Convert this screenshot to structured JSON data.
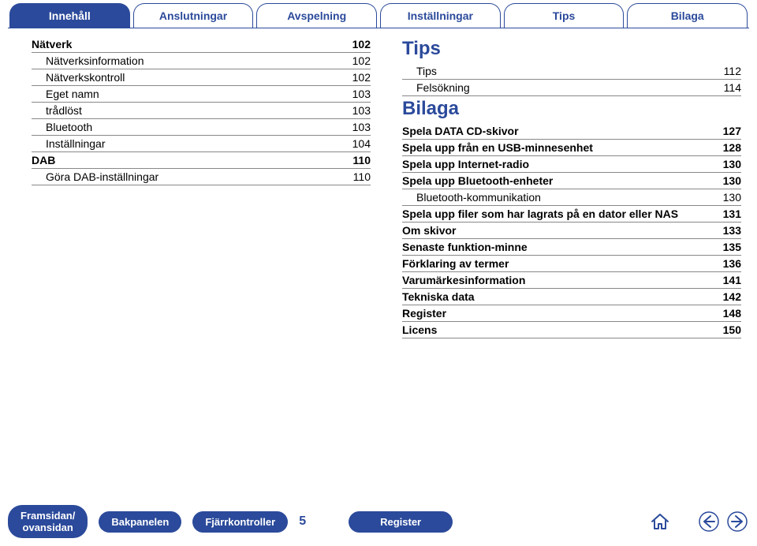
{
  "tabs": {
    "items": [
      {
        "label": "Innehåll",
        "active": true
      },
      {
        "label": "Anslutningar",
        "active": false
      },
      {
        "label": "Avspelning",
        "active": false
      },
      {
        "label": "Inställningar",
        "active": false
      },
      {
        "label": "Tips",
        "active": false
      },
      {
        "label": "Bilaga",
        "active": false
      }
    ]
  },
  "left_col": {
    "rows": [
      {
        "label": "Nätverk",
        "page": "102",
        "bold": true,
        "indent": 0
      },
      {
        "label": "Nätverksinformation",
        "page": "102",
        "bold": false,
        "indent": 1
      },
      {
        "label": "Nätverkskontroll",
        "page": "102",
        "bold": false,
        "indent": 1
      },
      {
        "label": "Eget namn",
        "page": "103",
        "bold": false,
        "indent": 1
      },
      {
        "label": "trådlöst",
        "page": "103",
        "bold": false,
        "indent": 1
      },
      {
        "label": "Bluetooth",
        "page": "103",
        "bold": false,
        "indent": 1
      },
      {
        "label": "Inställningar",
        "page": "104",
        "bold": false,
        "indent": 1
      },
      {
        "label": "DAB",
        "page": "110",
        "bold": true,
        "indent": 0
      },
      {
        "label": "Göra DAB-inställningar",
        "page": "110",
        "bold": false,
        "indent": 1
      }
    ]
  },
  "right_col": {
    "blocks": [
      {
        "title": "Tips",
        "rows": [
          {
            "label": "Tips",
            "page": "112",
            "bold": false,
            "indent": 1
          },
          {
            "label": "Felsökning",
            "page": "114",
            "bold": false,
            "indent": 1
          }
        ]
      },
      {
        "title": "Bilaga",
        "rows": [
          {
            "label": "Spela DATA CD-skivor",
            "page": "127",
            "bold": true,
            "indent": 0
          },
          {
            "label": "Spela upp från en USB-minnesenhet",
            "page": "128",
            "bold": true,
            "indent": 0
          },
          {
            "label": "Spela upp Internet-radio",
            "page": "130",
            "bold": true,
            "indent": 0
          },
          {
            "label": "Spela upp Bluetooth-enheter",
            "page": "130",
            "bold": true,
            "indent": 0
          },
          {
            "label": "Bluetooth-kommunikation",
            "page": "130",
            "bold": false,
            "indent": 1
          },
          {
            "label": "Spela upp filer som har lagrats på en dator eller NAS",
            "page": "131",
            "bold": true,
            "indent": 0
          },
          {
            "label": "Om skivor",
            "page": "133",
            "bold": true,
            "indent": 0
          },
          {
            "label": "Senaste funktion-minne",
            "page": "135",
            "bold": true,
            "indent": 0
          },
          {
            "label": "Förklaring av termer",
            "page": "136",
            "bold": true,
            "indent": 0
          },
          {
            "label": "Varumärkesinformation",
            "page": "141",
            "bold": true,
            "indent": 0
          },
          {
            "label": "Tekniska data",
            "page": "142",
            "bold": true,
            "indent": 0
          },
          {
            "label": "Register",
            "page": "148",
            "bold": true,
            "indent": 0
          },
          {
            "label": "Licens",
            "page": "150",
            "bold": true,
            "indent": 0
          }
        ]
      }
    ]
  },
  "bottombar": {
    "pills": [
      {
        "label": "Framsidan/\novansidan"
      },
      {
        "label": "Bakpanelen"
      },
      {
        "label": "Fjärrkontroller"
      }
    ],
    "page_number": "5",
    "register_label": "Register"
  }
}
